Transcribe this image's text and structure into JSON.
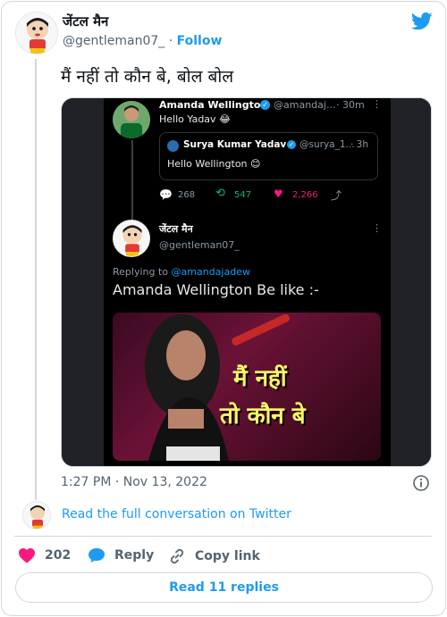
{
  "author": {
    "display_name": "जेंटल मैन",
    "handle": "@gentleman07_",
    "follow_label": "Follow",
    "separator": "·"
  },
  "tweet": {
    "text": "मैं नहीं तो कौन बे, बोल बोल",
    "timestamp": "1:27 PM · Nov 13, 2022"
  },
  "embedded": {
    "top_tweet": {
      "name": "Amanda Wellington",
      "handle": "@amandaj...",
      "time": "· 30m",
      "text": "Hello Yadav 😂"
    },
    "quoted": {
      "name": "Surya Kumar Yadav",
      "handle": "@surya_1...",
      "time": "· 3h",
      "text": "Hello Wellington 😊"
    },
    "stats": {
      "replies": "268",
      "retweets": "547",
      "likes": "2,266"
    },
    "reply_tweet": {
      "name": "जेंटल मैन",
      "handle": "@gentleman07_",
      "replying_prefix": "Replying to",
      "replying_to": "@amandajadew",
      "text": "Amanda Wellington Be like :-"
    },
    "meme_caption_line1": "मैं नहीं",
    "meme_caption_line2": "तो कौन बे"
  },
  "footer": {
    "read_conversation": "Read the full conversation on Twitter",
    "like_count": "202",
    "reply_label": "Reply",
    "copy_link_label": "Copy link",
    "read_replies_label": "Read 11 replies"
  },
  "colors": {
    "accent": "#1d9bf0",
    "like": "#f91880",
    "retweet": "#00ba7c",
    "meme_text": "#fff36b"
  }
}
